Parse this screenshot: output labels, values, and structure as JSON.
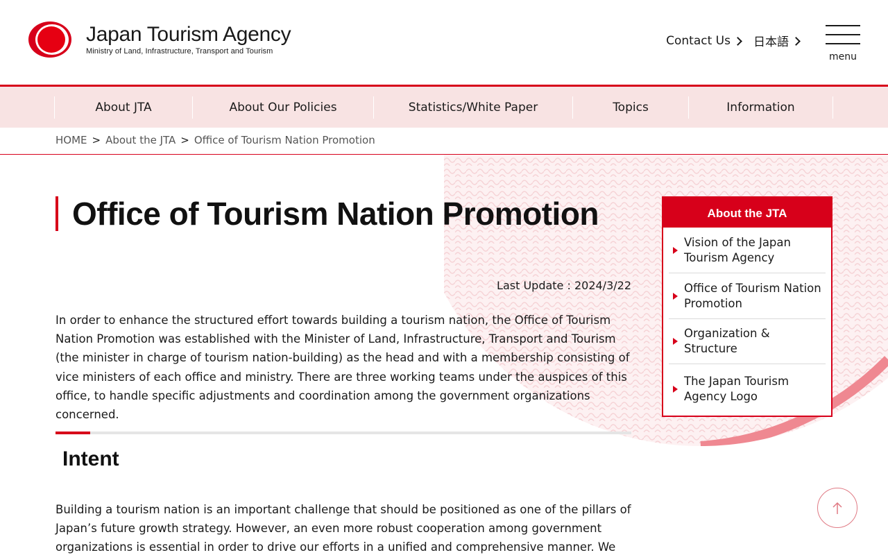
{
  "header": {
    "logo_title": "Japan Tourism Agency",
    "logo_subtitle": "Ministry of Land, Infrastructure, Transport and Tourism",
    "contact_label": "Contact Us",
    "language_label": "日本語",
    "menu_label": "menu"
  },
  "nav": {
    "items": [
      {
        "label": "About JTA"
      },
      {
        "label": "About Our Policies"
      },
      {
        "label": "Statistics/White Paper"
      },
      {
        "label": "Topics"
      },
      {
        "label": "Information"
      }
    ]
  },
  "breadcrumb": {
    "items": [
      "HOME",
      "About the JTA",
      "Office of Tourism Nation Promotion"
    ],
    "separator": ">"
  },
  "main": {
    "title": "Office of Tourism Nation Promotion",
    "last_update": "Last Update : 2024/3/22",
    "intro": "In order to enhance the structured effort towards building a tourism nation, the Office of Tourism Nation Promotion was established with the Minister of Land, Infrastructure, Transport and Tourism (the minister in charge of tourism nation-building) as the head and with a membership consisting of vice ministers of each office and ministry. There are three working teams under the auspices of this office, to handle specific adjustments and coordination among the government organizations concerned.",
    "section_title": "Intent",
    "section_body": "Building a tourism nation is an important challenge that should be positioned as one of the pillars of Japan’s future growth strategy. However, an even more robust cooperation among government organizations is essential in order to drive our efforts in a unified and comprehensive manner. We have"
  },
  "side_menu": {
    "heading": "About the JTA",
    "items": [
      {
        "label": "Vision of the Japan Tourism Agency"
      },
      {
        "label": "Office of Tourism Nation Promotion"
      },
      {
        "label": "Organization & Structure"
      },
      {
        "label": "The Japan Tourism Agency Logo"
      }
    ]
  },
  "colors": {
    "brand_red": "#d7001a",
    "nav_background": "#f8e3e3",
    "deco_pink": "#f4a7ad"
  },
  "icons": {
    "back_to_top": "arrow-up-icon",
    "chevron": "chevron-right-icon",
    "logo": "red-circle-logo-icon"
  }
}
